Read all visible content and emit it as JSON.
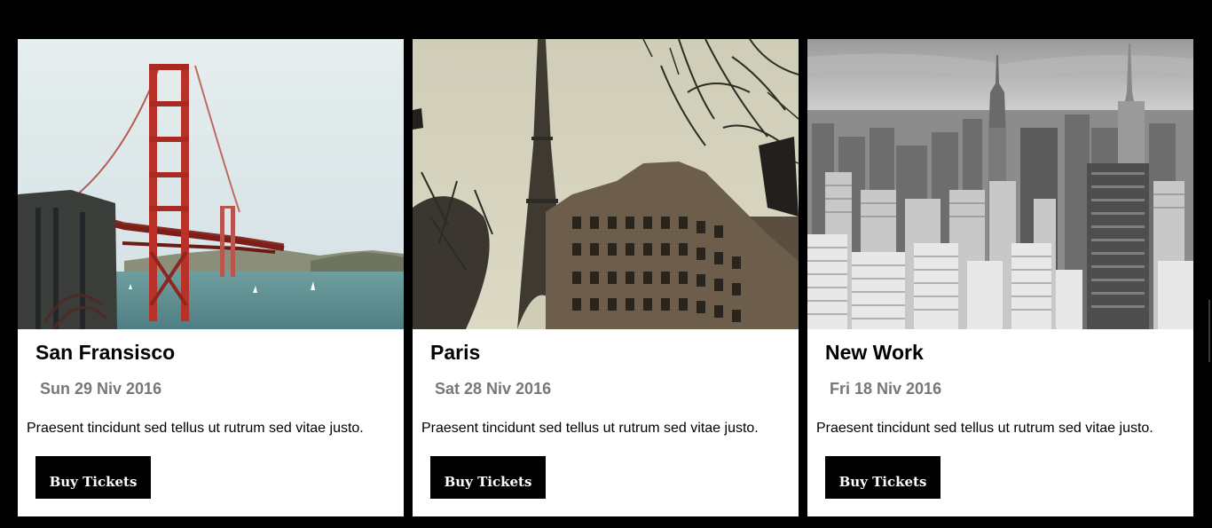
{
  "cards": [
    {
      "city": "San Fransisco",
      "date": "Sun 29 Niv 2016",
      "description": "Praesent tincidunt sed tellus ut rutrum sed vitae justo.",
      "button_label": "Buy Tickets",
      "image_subject": "golden-gate-bridge"
    },
    {
      "city": "Paris",
      "date": "Sat 28 Niv 2016",
      "description": "Praesent tincidunt sed tellus ut rutrum sed vitae justo.",
      "button_label": "Buy Tickets",
      "image_subject": "eiffel-tower"
    },
    {
      "city": "New Work",
      "date": "Fri 18 Niv 2016",
      "description": "Praesent tincidunt sed tellus ut rutrum sed vitae justo.",
      "button_label": "Buy Tickets",
      "image_subject": "manhattan-skyline"
    }
  ],
  "colors": {
    "background": "#000000",
    "card": "#ffffff",
    "title": "#000000",
    "date": "#777777",
    "button_bg": "#000000",
    "button_text": "#ffffff"
  }
}
